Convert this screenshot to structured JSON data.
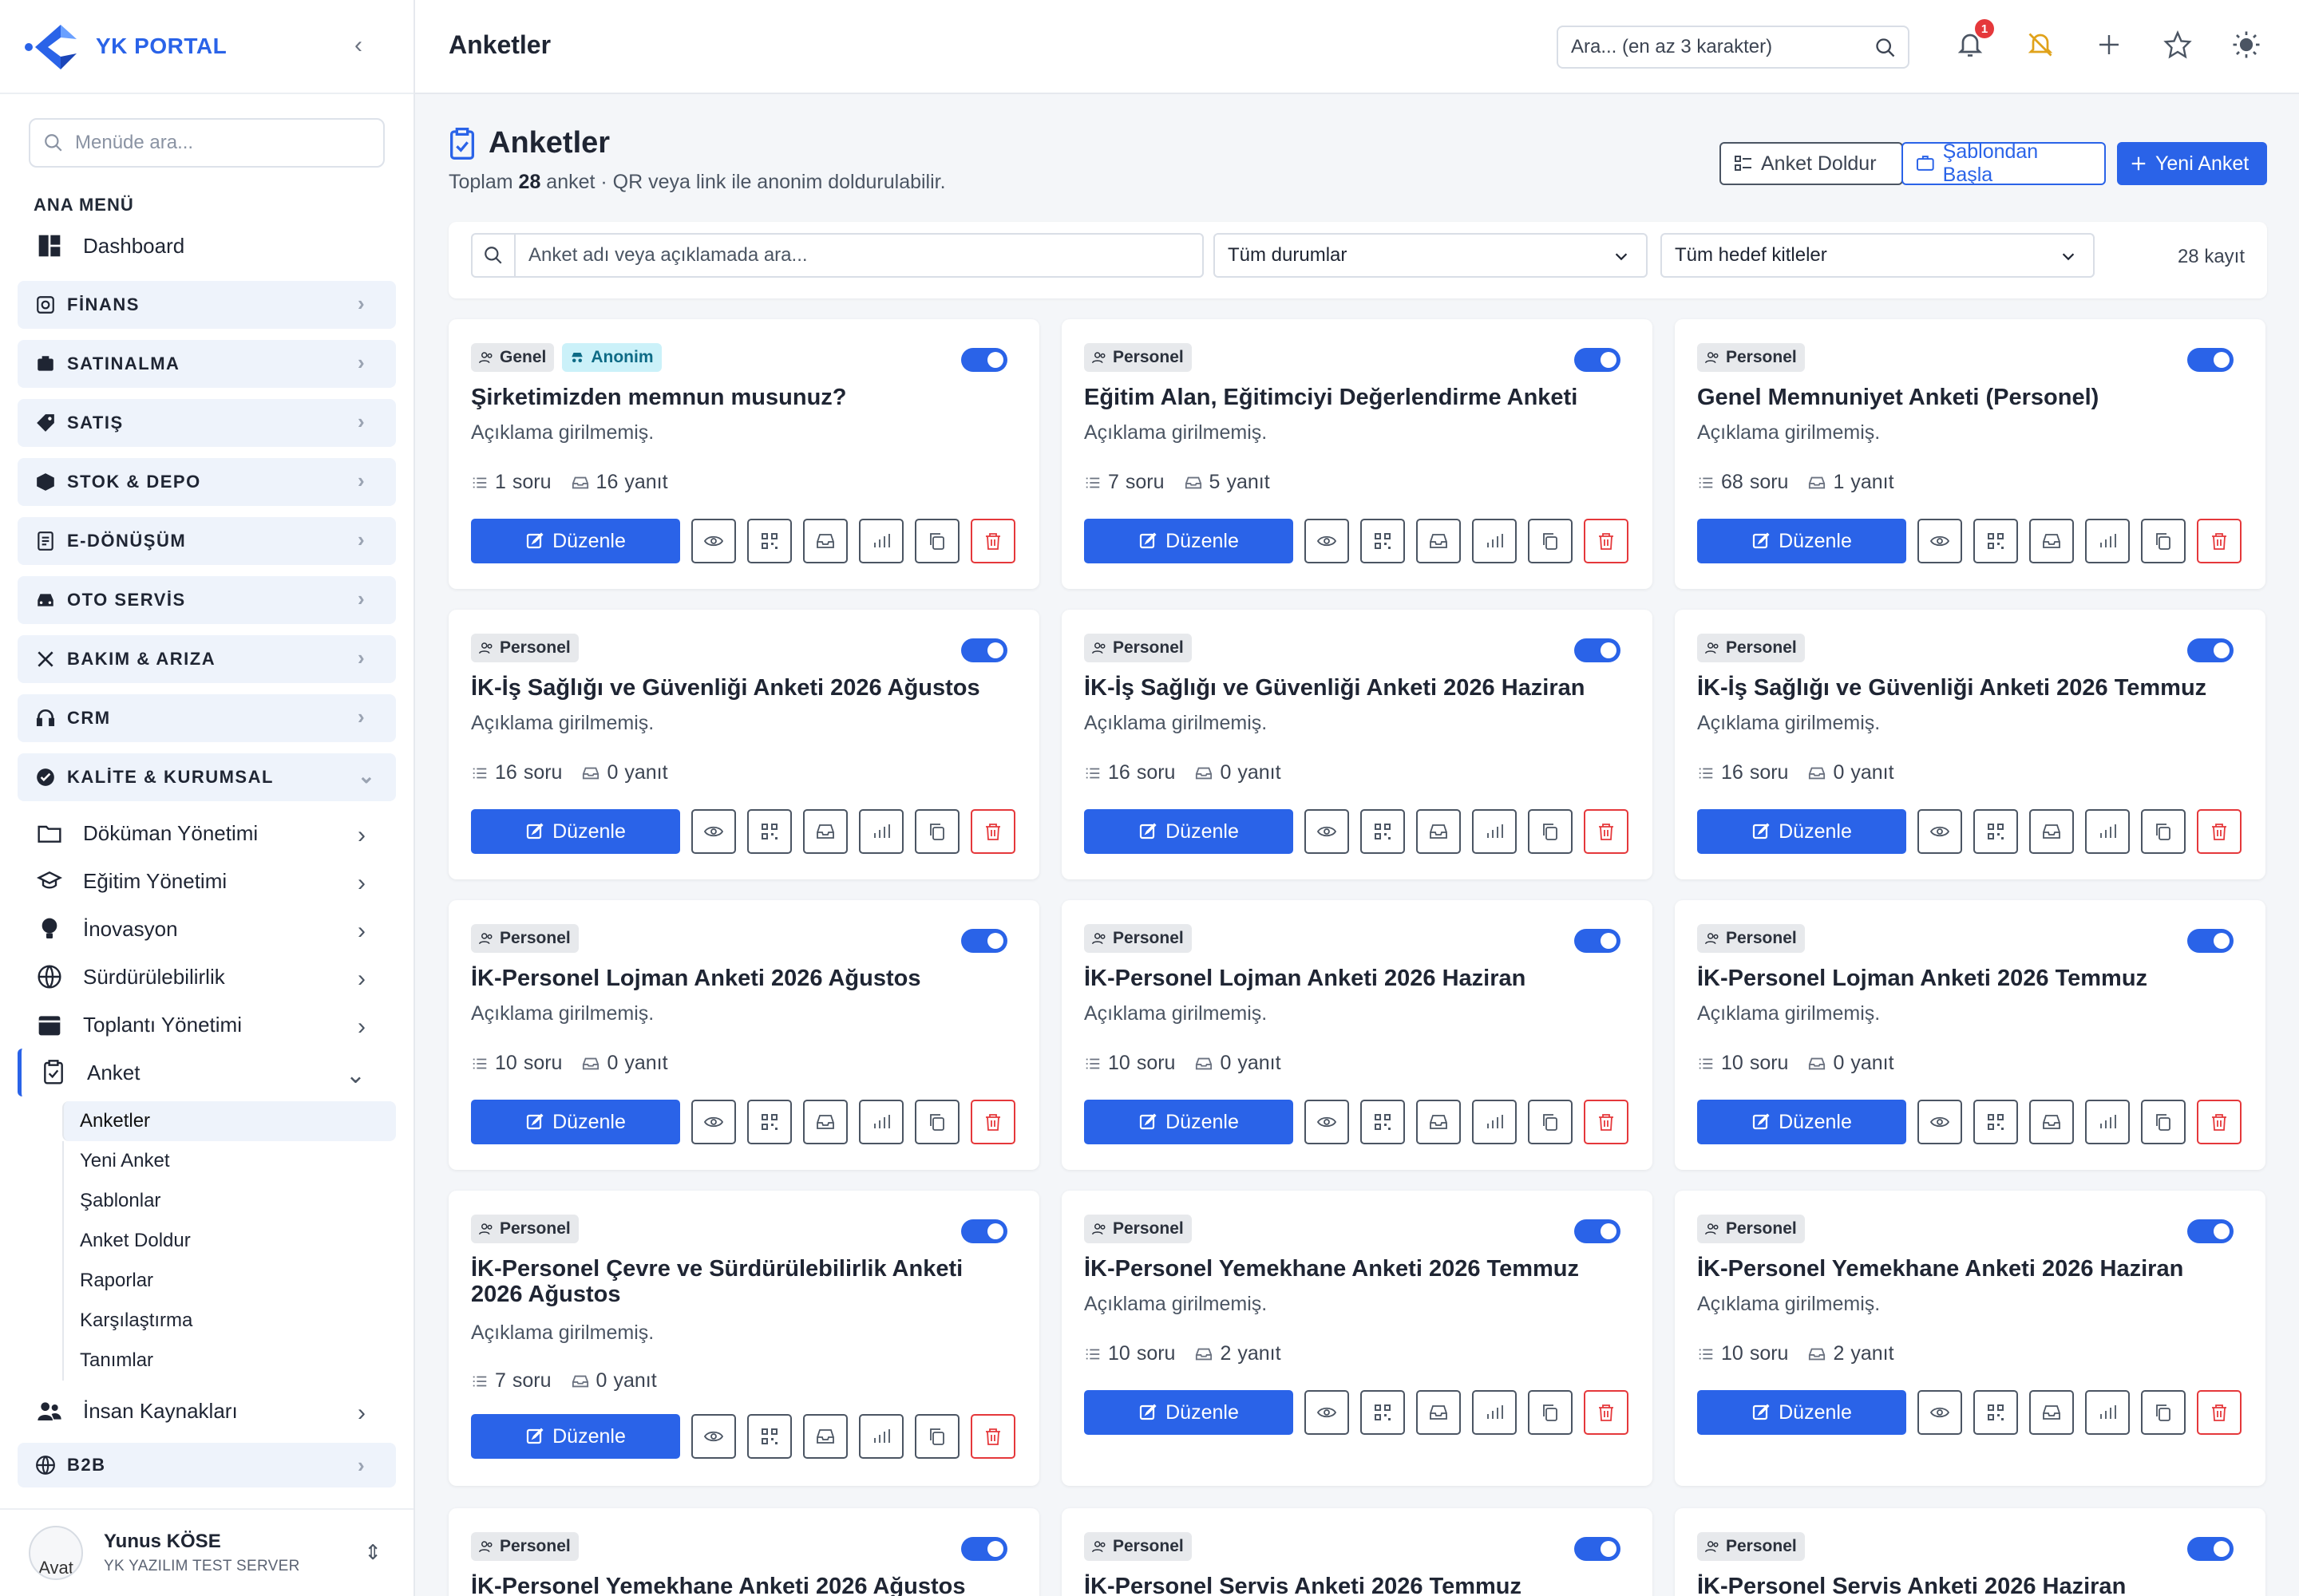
{
  "brand": {
    "name": "YK PORTAL"
  },
  "menu_search": {
    "placeholder": "Menüde ara..."
  },
  "sidebar": {
    "section_title": "ANA MENÜ",
    "dashboard": "Dashboard",
    "groups": [
      "FİNANS",
      "SATINALMA",
      "SATIŞ",
      "STOK & DEPO",
      "E-DÖNÜŞÜM",
      "OTO SERVİS",
      "BAKIM & ARIZA",
      "CRM",
      "KALİTE & KURUMSAL"
    ],
    "subs": [
      "Döküman Yönetimi",
      "Eğitim Yönetimi",
      "İnovasyon",
      "Sürdürülebilirlik",
      "Toplantı Yönetimi",
      "Anket"
    ],
    "anket_items": [
      "Anketler",
      "Yeni Anket",
      "Şablonlar",
      "Anket Doldur",
      "Raporlar",
      "Karşılaştırma",
      "Tanımlar"
    ],
    "after": "İnsan Kaynakları",
    "b2b": "B2B"
  },
  "user": {
    "name": "Yunus KÖSE",
    "company": "YK YAZILIM TEST SERVER",
    "avatar_alt": "Avat"
  },
  "topbar": {
    "title": "Anketler",
    "search_placeholder": "Ara... (en az 3 karakter)",
    "notif_count": "1"
  },
  "page": {
    "title": "Anketler",
    "subtitle_pre": "Toplam ",
    "total": "28",
    "subtitle_post": " anket · QR veya link ile anonim doldurulabilir.",
    "btn_fill": "Anket Doldur",
    "btn_template": "Şablondan Başla",
    "btn_new": "Yeni Anket"
  },
  "filters": {
    "search_placeholder": "Anket adı veya açıklamada ara...",
    "status": "Tüm durumlar",
    "audience": "Tüm hedef kitleler",
    "count": "28 kayıt"
  },
  "card_labels": {
    "edit": "Düzenle",
    "no_desc": "Açıklama girilmemiş.",
    "q_suffix": " soru",
    "a_suffix": " yanıt"
  },
  "colors": {
    "primary": "#2a63e8",
    "danger": "#e5383b"
  },
  "surveys": [
    {
      "title": "Şirketimizden memnun musunuz?",
      "tags": [
        "Genel",
        "Anonim"
      ],
      "questions": 1,
      "answers": 16
    },
    {
      "title": "Eğitim Alan, Eğitimciyi Değerlendirme Anketi",
      "tags": [
        "Personel"
      ],
      "questions": 7,
      "answers": 5
    },
    {
      "title": "Genel Memnuniyet Anketi (Personel)",
      "tags": [
        "Personel"
      ],
      "questions": 68,
      "answers": 1
    },
    {
      "title": "İK-İş Sağlığı ve Güvenliği Anketi 2026 Ağustos",
      "tags": [
        "Personel"
      ],
      "questions": 16,
      "answers": 0
    },
    {
      "title": "İK-İş Sağlığı ve Güvenliği Anketi 2026 Haziran",
      "tags": [
        "Personel"
      ],
      "questions": 16,
      "answers": 0
    },
    {
      "title": "İK-İş Sağlığı ve Güvenliği Anketi 2026 Temmuz",
      "tags": [
        "Personel"
      ],
      "questions": 16,
      "answers": 0
    },
    {
      "title": "İK-Personel Lojman Anketi 2026 Ağustos",
      "tags": [
        "Personel"
      ],
      "questions": 10,
      "answers": 0
    },
    {
      "title": "İK-Personel Lojman Anketi 2026 Haziran",
      "tags": [
        "Personel"
      ],
      "questions": 10,
      "answers": 0
    },
    {
      "title": "İK-Personel Lojman Anketi 2026 Temmuz",
      "tags": [
        "Personel"
      ],
      "questions": 10,
      "answers": 0
    },
    {
      "title": "İK-Personel Çevre ve Sürdürülebilirlik Anketi 2026 Ağustos",
      "tags": [
        "Personel"
      ],
      "questions": 7,
      "answers": 0
    },
    {
      "title": "İK-Personel Yemekhane Anketi 2026 Temmuz",
      "tags": [
        "Personel"
      ],
      "questions": 10,
      "answers": 2
    },
    {
      "title": "İK-Personel Yemekhane Anketi 2026 Haziran",
      "tags": [
        "Personel"
      ],
      "questions": 10,
      "answers": 2
    },
    {
      "title": "İK-Personel Yemekhane Anketi 2026 Ağustos",
      "tags": [
        "Personel"
      ]
    },
    {
      "title": "İK-Personel Servis Anketi 2026 Temmuz",
      "tags": [
        "Personel"
      ]
    },
    {
      "title": "İK-Personel Servis Anketi 2026 Haziran",
      "tags": [
        "Personel"
      ]
    }
  ]
}
